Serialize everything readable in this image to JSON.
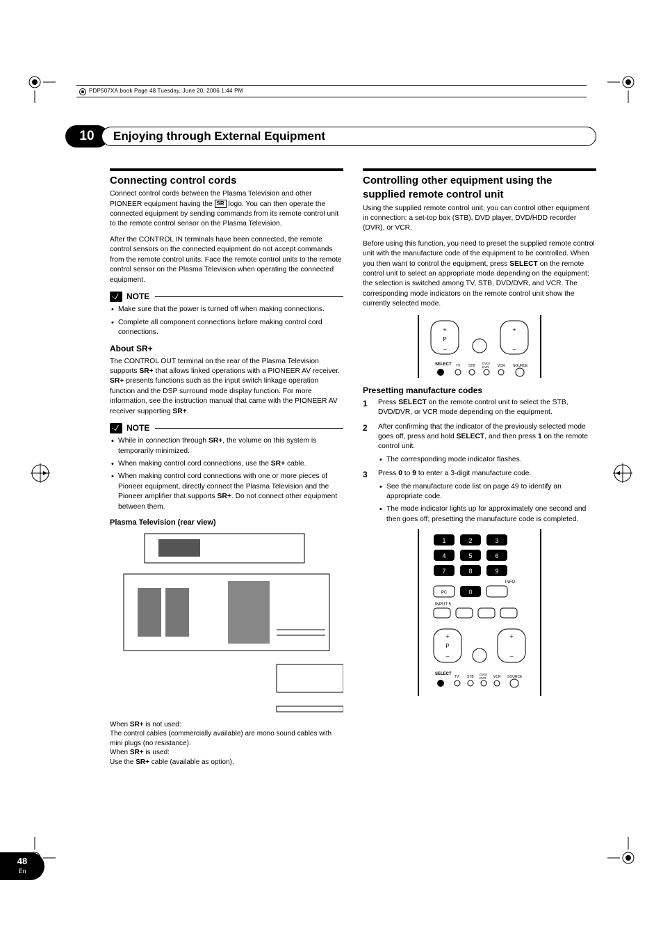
{
  "book_header": "PDP507XA.book  Page 48  Tuesday, June 20, 2006  1:44 PM",
  "chapter": {
    "number": "10",
    "title": "Enjoying through External Equipment"
  },
  "page": {
    "number": "48",
    "lang": "En"
  },
  "left": {
    "h_connecting": "Connecting control cords",
    "p_connect1_a": "Connect control cords between the Plasma Television and other PIONEER equipment having the ",
    "sr_logo": "SR",
    "p_connect1_b": " logo. You can then operate the connected equipment by sending commands from its remote control unit to the remote control sensor on the Plasma Television.",
    "p_connect2": "After the CONTROL IN terminals have been connected, the remote control sensors on the connected equipment do not accept commands from the remote control units. Face the remote control units to the remote control sensor on the Plasma Television when operating the connected equipment.",
    "note_label": "NOTE",
    "note1_li1": "Make sure that the power is turned off when making connections.",
    "note1_li2": "Complete all component connections before making control cord connections.",
    "h_about_sr": "About SR+",
    "p_about_a": "The CONTROL OUT terminal on the rear of the Plasma Television supports ",
    "srplus": "SR+",
    "p_about_b": " that allows linked operations with a PIONEER AV receiver. ",
    "p_about_c": " presents functions such as the input switch linkage operation function and the DSP surround mode display function. For more information, see the instruction manual that came with the PIONEER AV receiver supporting ",
    "p_about_d": ".",
    "note2_li1_a": "While in connection through ",
    "note2_li1_b": ", the volume on this system is temporarily minimized.",
    "note2_li2_a": "When making control cord connections, use the ",
    "note2_li2_b": " cable.",
    "note2_li3_a": "When making control cord connections with one or more pieces of Pioneer equipment, directly connect the Plasma Television and the Pioneer amplifier that supports ",
    "note2_li3_b": ". Do not connect other equipment between them.",
    "h_rear": "Plasma Television (rear view)",
    "cables_l1_a": "When ",
    "cables_l1_b": " is not used:",
    "cables_l2": "The control cables (commercially available) are mono sound cables with mini plugs (no resistance).",
    "cables_l3_a": "When ",
    "cables_l3_b": " is used:",
    "cables_l4_a": "Use the ",
    "cables_l4_b": " cable (available as option)."
  },
  "right": {
    "h_controlling": "Controlling other equipment using the supplied remote control unit",
    "p1": "Using the supplied remote control unit, you can control other equipment in connection: a set-top box (STB), DVD player, DVD/HDD recorder (DVR), or VCR.",
    "p2_a": "Before using this function, you need to preset the supplied remote control unit with the manufacture code of the equipment to be controlled. When you then want to control the equipment, press ",
    "select": "SELECT",
    "p2_b": " on the remote control unit to select an appropriate mode depending on the equipment; the selection is switched among TV, STB, DVD/DVR, and VCR. The corresponding mode indicators on the remote control unit show the currently selected mode.",
    "h_preset": "Presetting manufacture codes",
    "s1_a": "Press ",
    "s1_b": " on the remote control unit to select the STB, DVD/DVR, or VCR mode depending on the equipment.",
    "s2_a": "After confirming that the indicator of the previously selected mode goes off, press and hold ",
    "s2_b": ", and then press ",
    "one": "1",
    "s2_c": " on the remote control unit.",
    "s2_sub": "The corresponding mode indicator flashes.",
    "s3_a": "Press ",
    "zero": "0",
    "s3_b": " to ",
    "nine": "9",
    "s3_c": " to enter a 3-digit manufacture code.",
    "s3_sub1": "See the manufacture code list on page 49 to identify an appropriate code.",
    "s3_sub2": "The mode indicator lights up for approximately one second and then goes off; presetting the manufacture code is completed.",
    "remote_labels": {
      "select": "SELECT",
      "tv": "TV",
      "stb": "STB",
      "dvd": "DVD/\nDVR",
      "vcr": "VCR",
      "source": "SOURCE",
      "p": "P",
      "pc": "PC",
      "input5": "INPUT 5",
      "info": "INFO"
    }
  }
}
